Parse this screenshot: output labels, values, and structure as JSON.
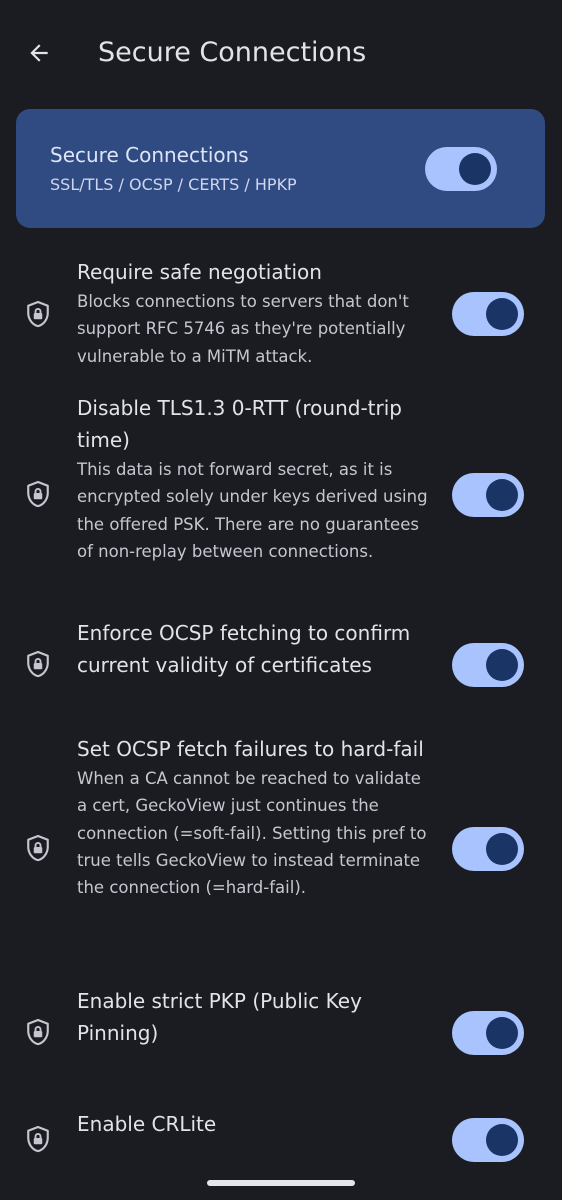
{
  "appbar": {
    "title": "Secure Connections"
  },
  "master": {
    "title": "Secure Connections",
    "subtitle": "SSL/TLS / OCSP / CERTS / HPKP",
    "enabled": true
  },
  "prefs": [
    {
      "title": "Require safe negotiation",
      "summary": "Blocks connections to servers that don't support RFC 5746 as they're potentially vulnerable to a MiTM attack.",
      "enabled": true
    },
    {
      "title": "Disable TLS1.3 0-RTT (round-trip time)",
      "summary": "This data is not forward secret, as it is encrypted solely under keys derived using the offered PSK. There are no guarantees of non-replay between connections.",
      "enabled": true
    },
    {
      "title": "Enforce OCSP fetching to confirm current validity of certificates",
      "summary": "",
      "enabled": true
    },
    {
      "title": "Set OCSP fetch failures to hard-fail",
      "summary": "When a CA cannot be reached to validate a cert, GeckoView just continues the connection (=soft-fail). Setting this pref to true tells GeckoView to instead terminate the connection (=hard-fail).",
      "enabled": true
    },
    {
      "title": "Enable strict PKP (Public Key Pinning)",
      "summary": "",
      "enabled": true
    },
    {
      "title": "Enable CRLite",
      "summary": "",
      "enabled": true
    }
  ],
  "icons": {
    "back": "arrow-back-icon",
    "row": "shield-lock-icon"
  },
  "colors": {
    "background": "#1b1c21",
    "card": "#2f4b82",
    "switch_track": "#a9c3ff",
    "switch_thumb": "#1a3466"
  }
}
